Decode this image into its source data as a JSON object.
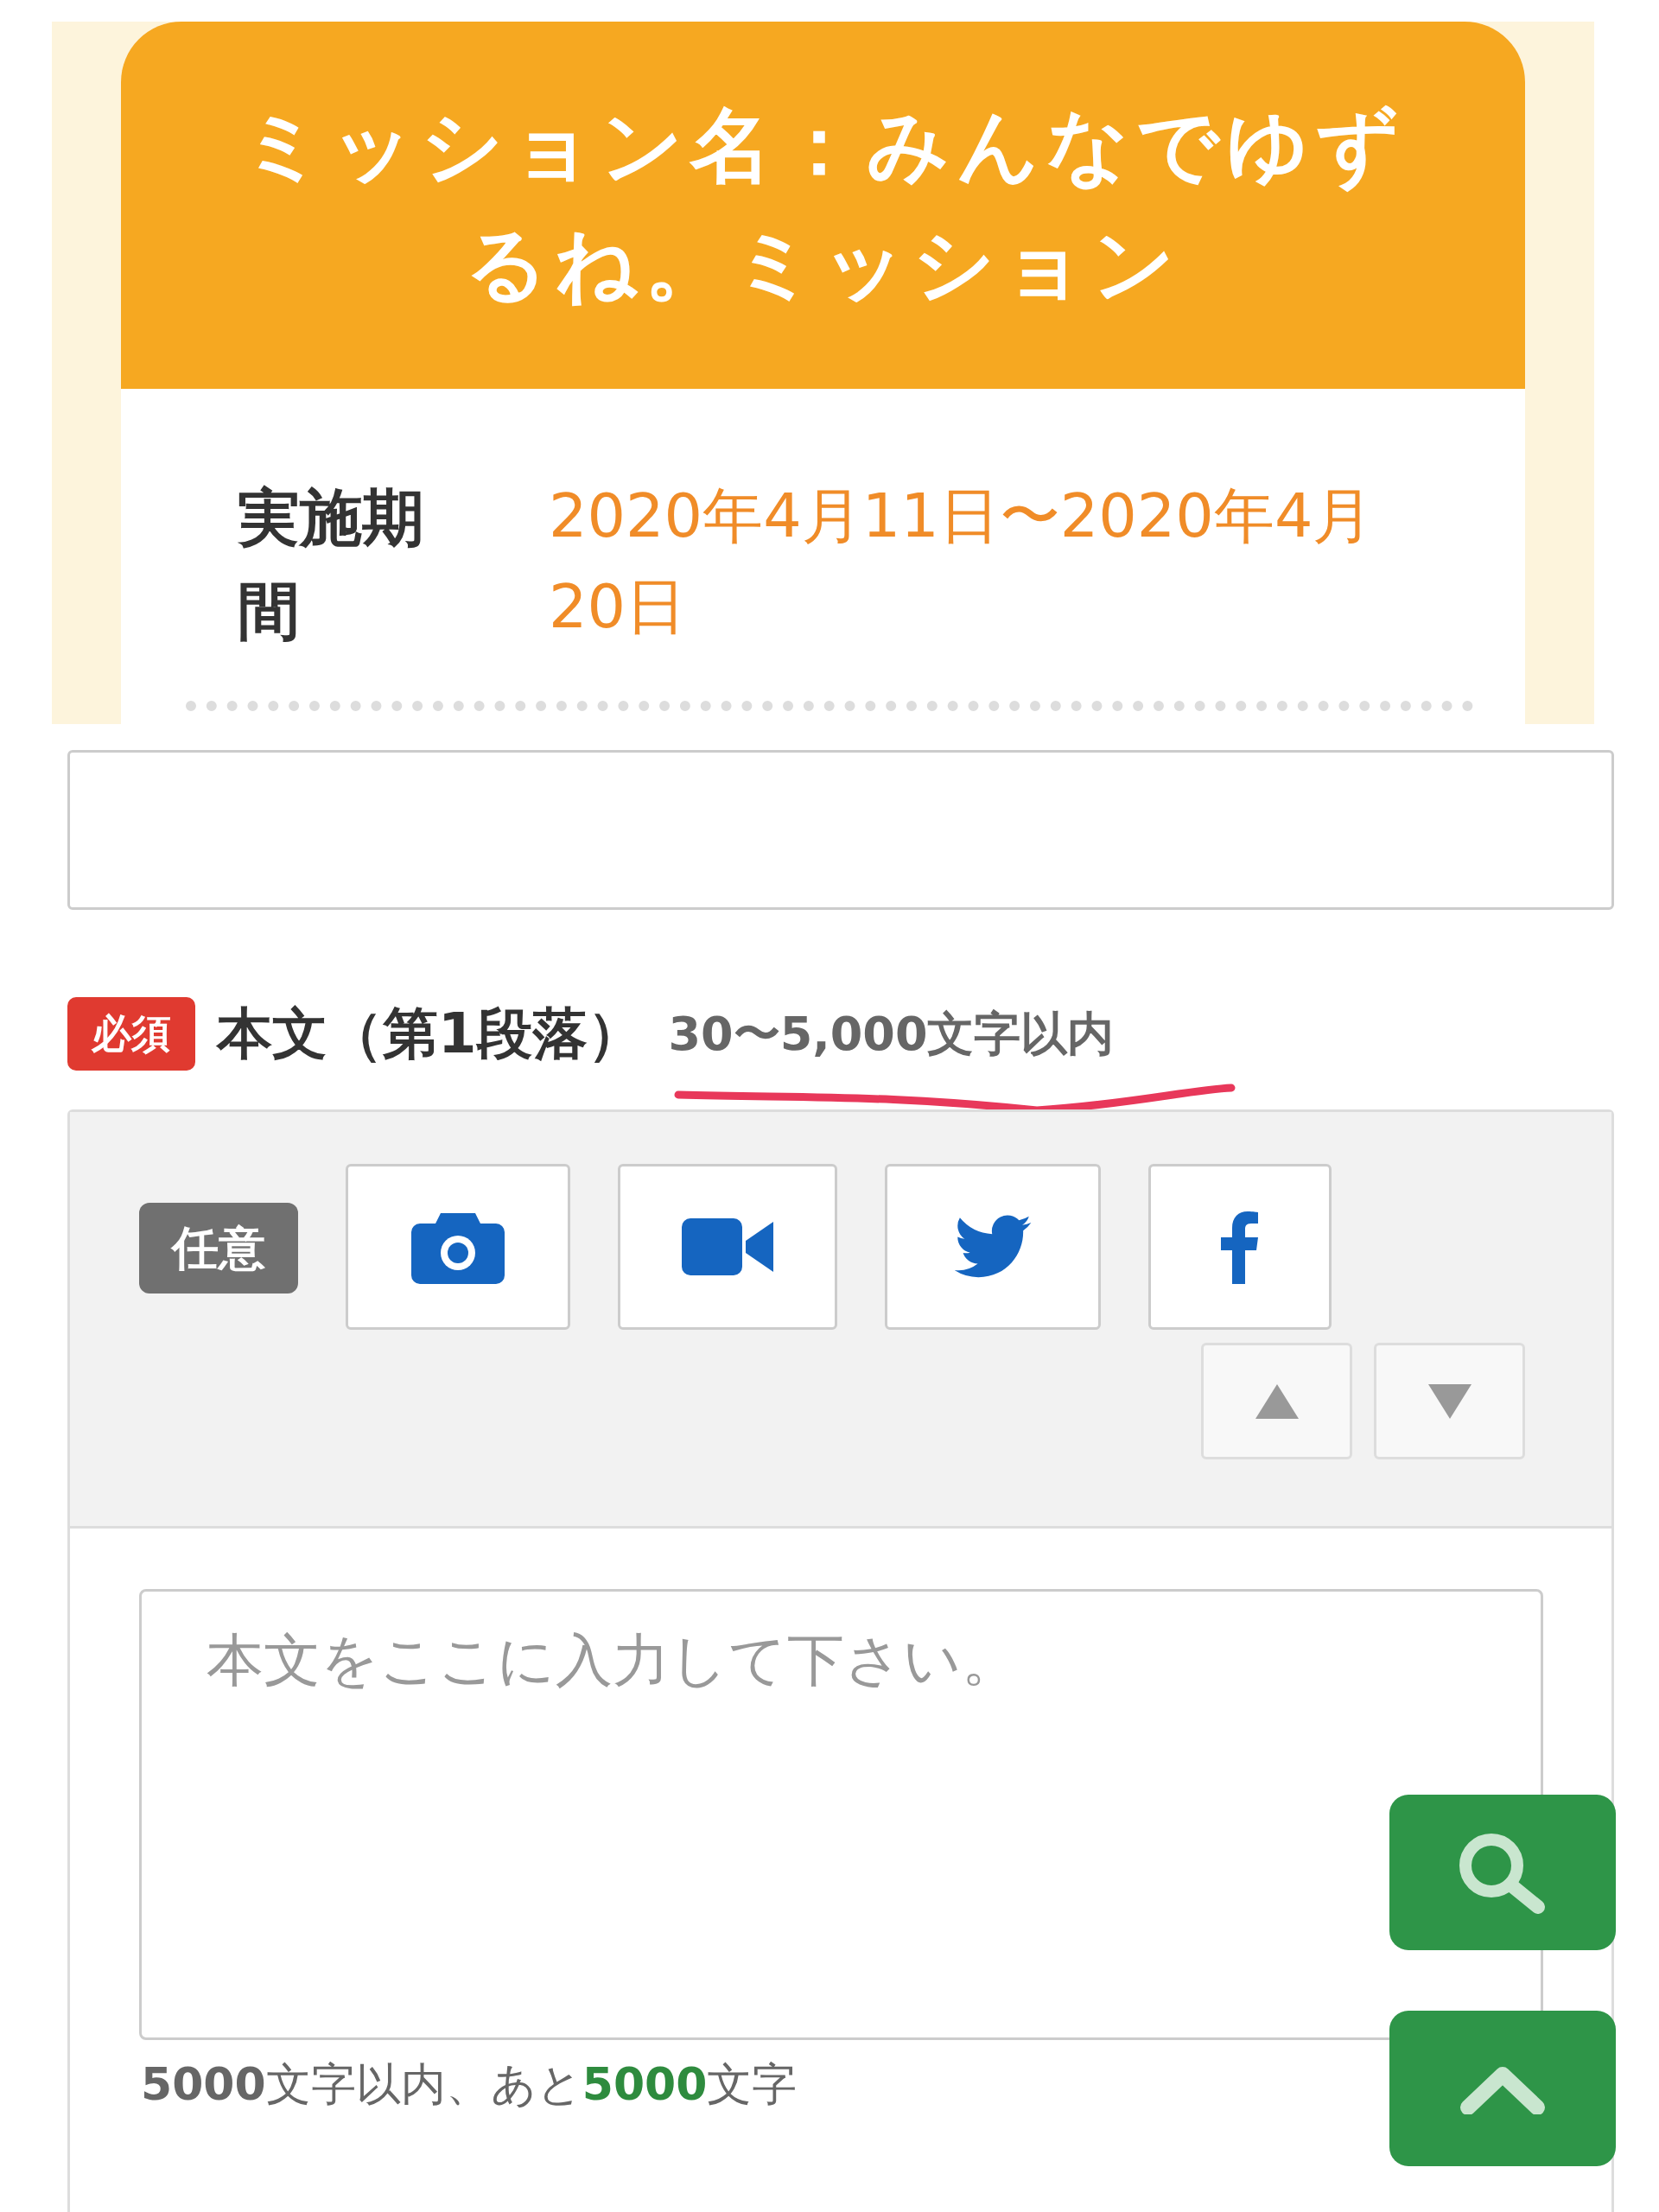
{
  "mission_card": {
    "title": "ミッション名：みんなでゆずるね。ミッション",
    "period_label": "実施期間",
    "period_value": "2020年4月11日〜2020年4月20日"
  },
  "paragraph": {
    "required_badge": "必須",
    "label": "本文（第1段落）",
    "limit": "30〜5,000文字以内",
    "optional_badge": "任意",
    "media_buttons": [
      {
        "kind": "camera"
      },
      {
        "kind": "video"
      },
      {
        "kind": "twitter"
      },
      {
        "kind": "facebook"
      }
    ],
    "move_buttons": [
      {
        "kind": "up"
      },
      {
        "kind": "down"
      }
    ],
    "placeholder": "本文をここに入力して下さい。",
    "counter": "**5000**文字以内、あと**5000**文字"
  },
  "floating_buttons": [
    {
      "kind": "search"
    },
    {
      "kind": "top"
    }
  ]
}
